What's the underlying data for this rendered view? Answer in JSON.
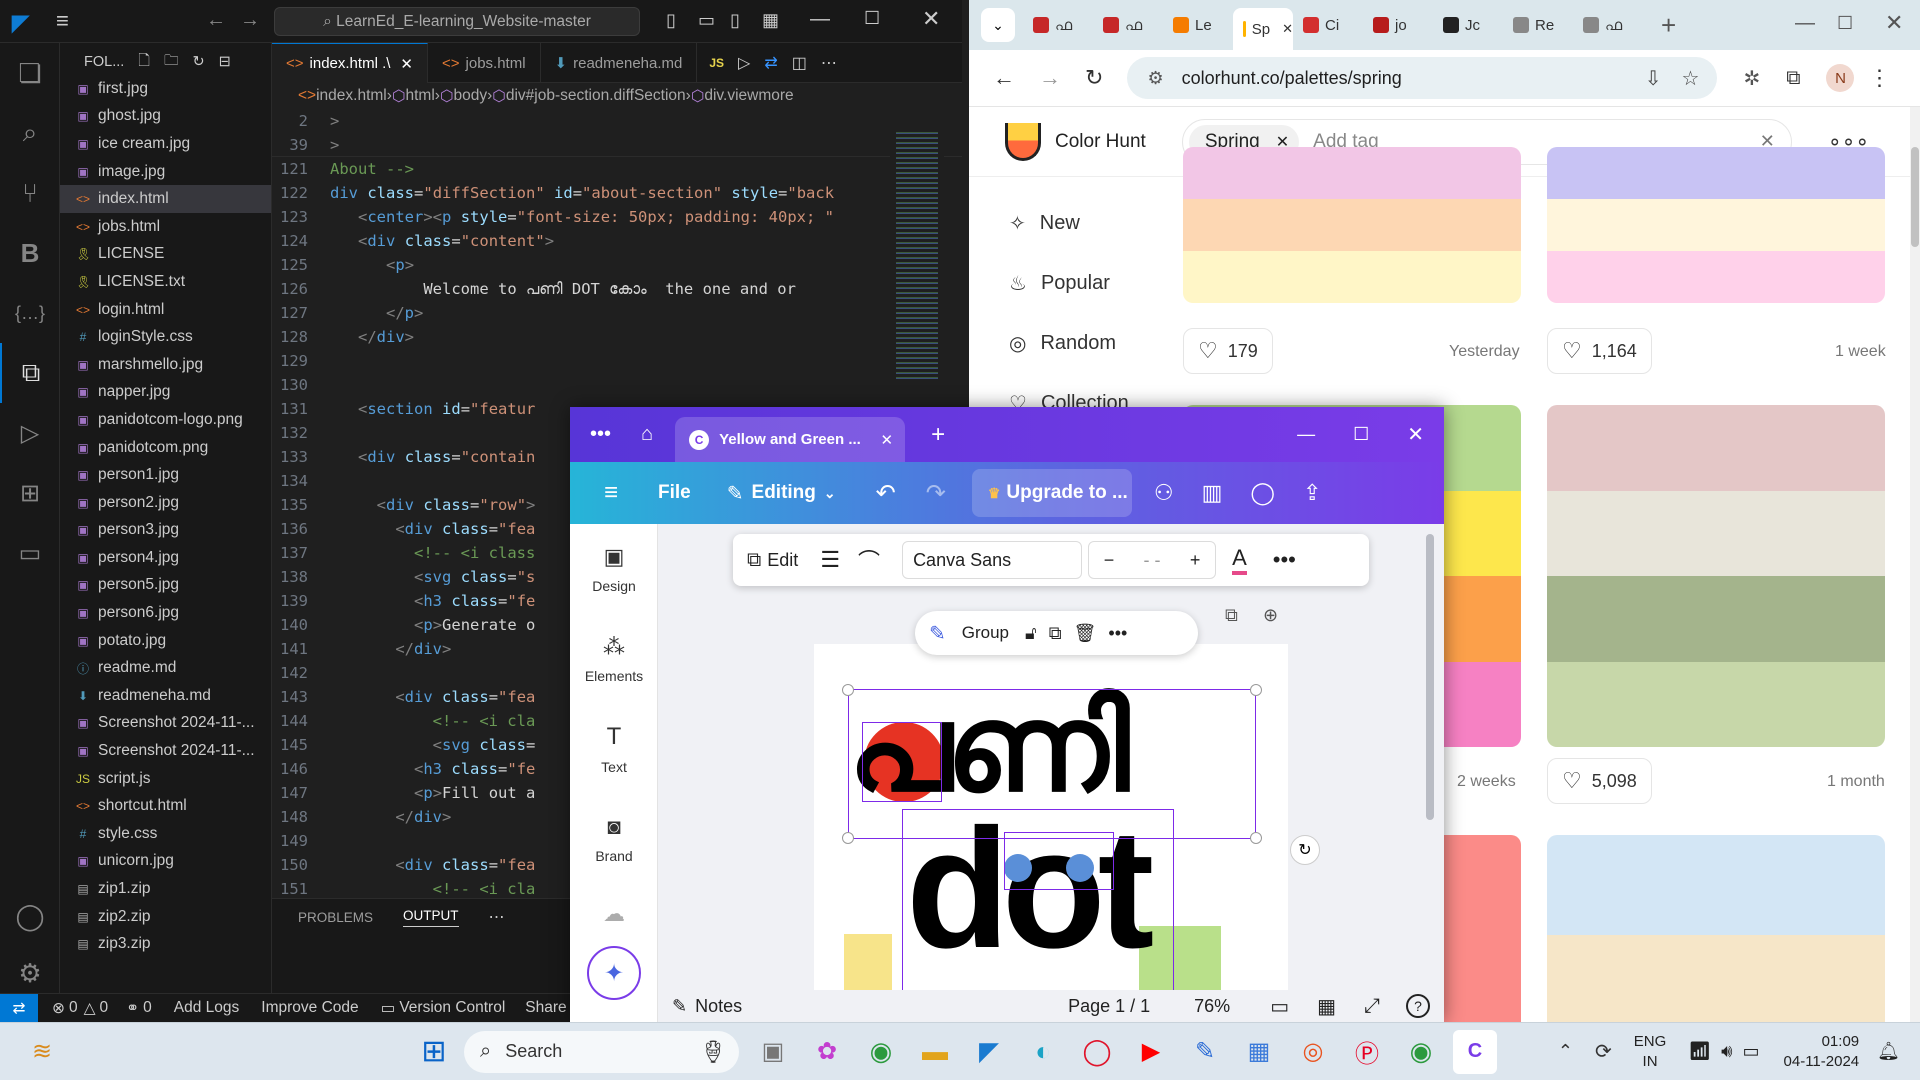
{
  "vscode": {
    "search_label": "LearnEd_E-learning_Website-master",
    "explorer_label": "FOL...",
    "files": [
      {
        "name": "first.jpg",
        "type": "img"
      },
      {
        "name": "ghost.jpg",
        "type": "img"
      },
      {
        "name": "ice cream.jpg",
        "type": "img"
      },
      {
        "name": "image.jpg",
        "type": "img"
      },
      {
        "name": "index.html",
        "type": "html",
        "selected": true
      },
      {
        "name": "jobs.html",
        "type": "html"
      },
      {
        "name": "LICENSE",
        "type": "lic"
      },
      {
        "name": "LICENSE.txt",
        "type": "lic"
      },
      {
        "name": "login.html",
        "type": "html"
      },
      {
        "name": "loginStyle.css",
        "type": "css"
      },
      {
        "name": "marshmello.jpg",
        "type": "img"
      },
      {
        "name": "napper.jpg",
        "type": "img"
      },
      {
        "name": "panidotcom-logo.png",
        "type": "img"
      },
      {
        "name": "panidotcom.png",
        "type": "img"
      },
      {
        "name": "person1.jpg",
        "type": "img"
      },
      {
        "name": "person2.jpg",
        "type": "img"
      },
      {
        "name": "person3.jpg",
        "type": "img"
      },
      {
        "name": "person4.jpg",
        "type": "img"
      },
      {
        "name": "person5.jpg",
        "type": "img"
      },
      {
        "name": "person6.jpg",
        "type": "img"
      },
      {
        "name": "potato.jpg",
        "type": "img"
      },
      {
        "name": "readme.md",
        "type": "info"
      },
      {
        "name": "readmeneha.md",
        "type": "md"
      },
      {
        "name": "Screenshot 2024-11-...",
        "type": "img"
      },
      {
        "name": "Screenshot 2024-11-...",
        "type": "img"
      },
      {
        "name": "script.js",
        "type": "js"
      },
      {
        "name": "shortcut.html",
        "type": "html"
      },
      {
        "name": "style.css",
        "type": "css"
      },
      {
        "name": "unicorn.jpg",
        "type": "img"
      },
      {
        "name": "zip1.zip",
        "type": "zip"
      },
      {
        "name": "zip2.zip",
        "type": "zip"
      },
      {
        "name": "zip3.zip",
        "type": "zip"
      }
    ],
    "tabs": [
      {
        "label": "index.html .\\",
        "active": true
      },
      {
        "label": "jobs.html",
        "active": false
      },
      {
        "label": "readmeneha.md",
        "active": false
      }
    ],
    "breadcrumb": [
      "index.html",
      "html",
      "body",
      "div#job-section.diffSection",
      "div.viewmore"
    ],
    "code_lines": [
      {
        "n": "2",
        "html": "<span class='pn'>&gt;</span>"
      },
      {
        "n": "39",
        "html": "<span class='pn'>&gt;</span>"
      },
      {
        "n": "121",
        "html": "<span class='cm'>About --&gt;</span>"
      },
      {
        "n": "122",
        "html": "<span class='tg'>div</span> <span class='at'>class</span>=<span class='st'>\"diffSection\"</span> <span class='at'>id</span>=<span class='st'>\"about-section\"</span> <span class='at'>style</span>=<span class='st'>\"back</span>"
      },
      {
        "n": "123",
        "html": "   <span class='pn'>&lt;</span><span class='tg'>center</span><span class='pn'>&gt;&lt;</span><span class='tg'>p</span> <span class='at'>style</span>=<span class='st'>\"font-size: 50px; padding: 40px; \"</span>"
      },
      {
        "n": "124",
        "html": "   <span class='pn'>&lt;</span><span class='tg'>div</span> <span class='at'>class</span>=<span class='st'>\"content\"</span><span class='pn'>&gt;</span>"
      },
      {
        "n": "125",
        "html": "      <span class='pn'>&lt;</span><span class='tg'>p</span><span class='pn'>&gt;</span>"
      },
      {
        "n": "126",
        "html": "          <span class='tx'>Welcome to പണി DOT കോം  the one and or</span>"
      },
      {
        "n": "127",
        "html": "      <span class='pn'>&lt;/</span><span class='tg'>p</span><span class='pn'>&gt;</span>"
      },
      {
        "n": "128",
        "html": "   <span class='pn'>&lt;/</span><span class='tg'>div</span><span class='pn'>&gt;</span>"
      },
      {
        "n": "129",
        "html": ""
      },
      {
        "n": "130",
        "html": ""
      },
      {
        "n": "131",
        "html": "   <span class='pn'>&lt;</span><span class='tg'>section</span> <span class='at'>id</span>=<span class='st'>\"featur</span>"
      },
      {
        "n": "132",
        "html": ""
      },
      {
        "n": "133",
        "html": "   <span class='pn'>&lt;</span><span class='tg'>div</span> <span class='at'>class</span>=<span class='st'>\"contain</span>"
      },
      {
        "n": "134",
        "html": ""
      },
      {
        "n": "135",
        "html": "     <span class='pn'>&lt;</span><span class='tg'>div</span> <span class='at'>class</span>=<span class='st'>\"row\"</span><span class='pn'>&gt;</span>"
      },
      {
        "n": "136",
        "html": "       <span class='pn'>&lt;</span><span class='tg'>div</span> <span class='at'>class</span>=<span class='st'>\"fea</span>"
      },
      {
        "n": "137",
        "html": "         <span class='cm'>&lt;!-- &lt;i class</span>"
      },
      {
        "n": "138",
        "html": "         <span class='pn'>&lt;</span><span class='tg'>svg</span> <span class='at'>class</span>=<span class='st'>\"s</span>"
      },
      {
        "n": "139",
        "html": "         <span class='pn'>&lt;</span><span class='tg'>h3</span> <span class='at'>class</span>=<span class='st'>\"fe</span>"
      },
      {
        "n": "140",
        "html": "         <span class='pn'>&lt;</span><span class='tg'>p</span><span class='pn'>&gt;</span><span class='tx'>Generate o</span>"
      },
      {
        "n": "141",
        "html": "       <span class='pn'>&lt;/</span><span class='tg'>div</span><span class='pn'>&gt;</span>"
      },
      {
        "n": "142",
        "html": ""
      },
      {
        "n": "143",
        "html": "       <span class='pn'>&lt;</span><span class='tg'>div</span> <span class='at'>class</span>=<span class='st'>\"fea</span>"
      },
      {
        "n": "144",
        "html": "           <span class='cm'>&lt;!-- &lt;i cla</span>"
      },
      {
        "n": "145",
        "html": "           <span class='pn'>&lt;</span><span class='tg'>svg</span> <span class='at'>class</span>=<span class='pn'></span>"
      },
      {
        "n": "146",
        "html": "         <span class='pn'>&lt;</span><span class='tg'>h3</span> <span class='at'>class</span>=<span class='st'>\"fe</span>"
      },
      {
        "n": "147",
        "html": "         <span class='pn'>&lt;</span><span class='tg'>p</span><span class='pn'>&gt;</span><span class='tx'>Fill out a</span>"
      },
      {
        "n": "148",
        "html": "       <span class='pn'>&lt;/</span><span class='tg'>div</span><span class='pn'>&gt;</span>"
      },
      {
        "n": "149",
        "html": ""
      },
      {
        "n": "150",
        "html": "       <span class='pn'>&lt;</span><span class='tg'>div</span> <span class='at'>class</span>=<span class='st'>\"fea</span>"
      },
      {
        "n": "151",
        "html": "           <span class='cm'>&lt;!-- &lt;i cla</span>"
      }
    ],
    "panel_tabs": [
      "PROBLEMS",
      "OUTPUT"
    ],
    "status": {
      "errors": "0",
      "warnings": "0",
      "ports": "0",
      "add_logs": "Add Logs",
      "improve": "Improve Code",
      "vc": "Version Control",
      "share": "Share C"
    }
  },
  "chrome": {
    "tabs": [
      {
        "label": "ഫ",
        "icon": "red"
      },
      {
        "label": "ഫ",
        "icon": "red"
      },
      {
        "label": "Le",
        "icon": "orange"
      },
      {
        "label": "Sp",
        "icon": "hunt",
        "active": true
      },
      {
        "label": "Ci",
        "icon": "red2"
      },
      {
        "label": "jo",
        "icon": "red3"
      },
      {
        "label": "Jc",
        "icon": "dark"
      },
      {
        "label": "Re",
        "icon": "gray"
      },
      {
        "label": "ഫ",
        "icon": "gray"
      }
    ],
    "url": "colorhunt.co/palettes/spring",
    "profile": "N"
  },
  "colorhunt": {
    "brand": "Color Hunt",
    "tag": "Spring",
    "add_tag": "Add tag",
    "nav": [
      "New",
      "Popular",
      "Random",
      "Collection"
    ],
    "cards": [
      {
        "colors": [
          "#f2c6e6",
          "#fdd7b3",
          "#fff6c7"
        ],
        "likes": "179",
        "ago": "Yesterday"
      },
      {
        "colors": [
          "#c8c3f4",
          "#fff5dc",
          "#ffd1ea"
        ],
        "likes": "1,164",
        "ago": "1 week"
      },
      {
        "colors": [
          "#b5d98f",
          "#fde74c",
          "#fca04a",
          "#f681c3"
        ],
        "likes": "",
        "ago": "2 weeks"
      },
      {
        "colors": [
          "#e4c7c7",
          "#e8e5da",
          "#a4b48c",
          "#c7d7a9"
        ],
        "likes": "5,098",
        "ago": "1 month"
      },
      {
        "colors": [
          "#fb8b88"
        ],
        "likes": "",
        "ago": ""
      },
      {
        "colors": [
          "#d3e6f5",
          "#f6e6c8"
        ],
        "likes": "",
        "ago": ""
      }
    ]
  },
  "canva": {
    "tab_title": "Yellow and Green ...",
    "file": "File",
    "editing": "Editing",
    "upgrade": "Upgrade to ...",
    "left_tools": [
      "Design",
      "Elements",
      "Text",
      "Brand"
    ],
    "float": {
      "edit": "Edit",
      "font": "Canva Sans",
      "size": "- -"
    },
    "group": "Group",
    "canvas_title": "പണി",
    "canvas_sub": "dot",
    "notes": "Notes",
    "page": "Page 1 / 1",
    "zoom": "76%"
  },
  "taskbar": {
    "search": "Search",
    "lang1": "ENG",
    "lang2": "IN",
    "time": "01:09",
    "date": "04-11-2024"
  }
}
